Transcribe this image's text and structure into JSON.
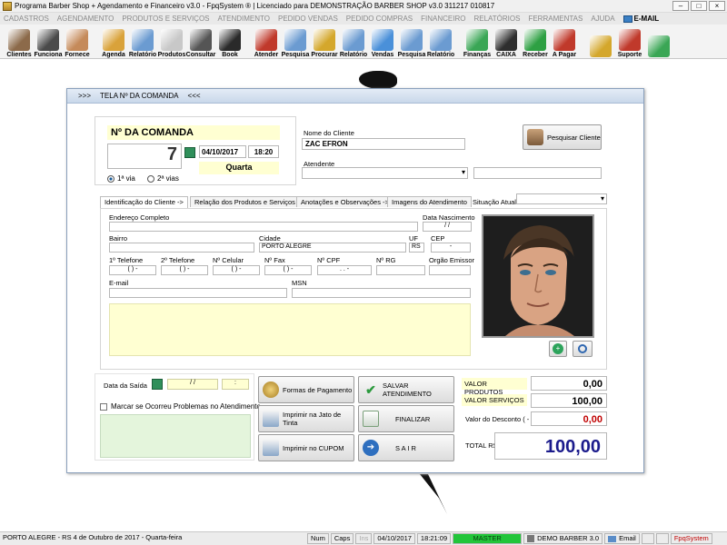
{
  "window": {
    "title": "Programa Barber Shop + Agendamento e Financeiro v3.0 - FpqSystem ® | Licenciado para  DEMONSTRAÇÃO BARBER SHOP v3.0 311217 010817"
  },
  "menu": [
    "CADASTROS",
    "AGENDAMENTO",
    "PRODUTOS E SERVIÇOS",
    "ATENDIMENTO",
    "PEDIDO VENDAS",
    "PEDIDO COMPRAS",
    "FINANCEIRO",
    "RELATÓRIOS",
    "FERRAMENTAS",
    "AJUDA"
  ],
  "menu_email": "E-MAIL",
  "toolbar": [
    {
      "label": "Clientes",
      "color": "#8c6a4a"
    },
    {
      "label": "Funciona",
      "color": "#4a4a4a"
    },
    {
      "label": "Fornece",
      "color": "#c58a5a"
    },
    {
      "label": "Agenda",
      "color": "#d9a23a"
    },
    {
      "label": "Relatório",
      "color": "#6b9bd1"
    },
    {
      "label": "Produtos",
      "color": "#c8c8c8"
    },
    {
      "label": "Consultar",
      "color": "#555555"
    },
    {
      "label": "Book",
      "color": "#2a2a2a"
    },
    {
      "label": "Atender",
      "color": "#c0392b"
    },
    {
      "label": "Pesquisa",
      "color": "#6b9bd1"
    },
    {
      "label": "Procurar",
      "color": "#d4a72c"
    },
    {
      "label": "Relatório",
      "color": "#6b9bd1"
    },
    {
      "label": "Vendas",
      "color": "#4a90d9"
    },
    {
      "label": "Pesquisa",
      "color": "#6b9bd1"
    },
    {
      "label": "Relatório",
      "color": "#6b9bd1"
    },
    {
      "label": "Finanças",
      "color": "#3aa655"
    },
    {
      "label": "CAIXA",
      "color": "#2e2e2e"
    },
    {
      "label": "Receber",
      "color": "#2ea043"
    },
    {
      "label": "A Pagar",
      "color": "#c0392b"
    },
    {
      "label": "",
      "color": "#d4a72c"
    },
    {
      "label": "Suporte",
      "color": "#c0392b"
    },
    {
      "label": "",
      "color": "#3aa655"
    }
  ],
  "dialog": {
    "caption_left": ">>>",
    "caption": "TELA Nº DA COMANDA",
    "caption_right": "<<<",
    "comanda_label": "Nº DA COMANDA",
    "comanda_number": "7",
    "date": "04/10/2017",
    "time": "18:20",
    "weekday": "Quarta",
    "via1": "1ª via",
    "via2": "2ª vias",
    "cliente_label": "Nome do Cliente",
    "cliente_value": "ZAC EFRON",
    "pesquisar_button": "Pesquisar Cliente",
    "atendente_label": "Atendente",
    "tabs": [
      "Identificação do Cliente ->",
      "Relação dos Produtos e Serviços ->",
      "Anotações e Observações ->",
      "Imagens do Atendimento"
    ],
    "situacao_label": "Situação Atual",
    "endereco_label": "Endereço Completo",
    "nascimento_label": "Data Nascimento",
    "nascimento_value": "/ /",
    "bairro_label": "Bairro",
    "cidade_label": "Cidade",
    "cidade_value": "PORTO ALEGRE",
    "uf_label": "UF",
    "uf_value": "RS",
    "cep_label": "CEP",
    "cep_value": "-",
    "tel1_label": "1º Telefone",
    "tel1_value": "( )   -",
    "tel2_label": "2º Telefone",
    "tel2_value": "( )   -",
    "cel_label": "Nº Celular",
    "cel_value": "( )   -",
    "fax_label": "Nº Fax",
    "fax_value": "( )   -",
    "cpf_label": "Nº CPF",
    "cpf_value": ".   .   -",
    "rg_label": "Nº RG",
    "orgao_label": "Orgão Emissor",
    "email_label": "E-mail",
    "msn_label": "MSN",
    "data_saida_label": "Data da Saída",
    "data_saida_value": "/ /",
    "hora_saida_value": ":",
    "problemas_label": "Marcar se Ocorreu Problemas no Atendimento",
    "btn_formas": "Formas de Pagamento",
    "btn_imprimir_jato": "Imprimir na Jato de Tinta",
    "btn_imprimir_cupom": "Imprimir no CUPOM",
    "btn_salvar": "SALVAR  ATENDIMENTO",
    "btn_finalizar": "FINALIZAR",
    "btn_sair": "S A I R",
    "valor_produtos_label": "VALOR PRODUTOS",
    "valor_produtos": "0,00",
    "valor_servicos_label": "VALOR SERVIÇOS",
    "valor_servicos": "100,00",
    "desconto_label": "Valor do Desconto ( - )",
    "desconto": "0,00",
    "total_label": "TOTAL R$",
    "total": "100,00"
  },
  "statusbar": {
    "location": "PORTO ALEGRE - RS   4 de Outubro de 2017 - Quarta-feira",
    "num": "Num",
    "caps": "Caps",
    "ins": "Ins",
    "date": "04/10/2017",
    "time": "18:21:09",
    "master": "MASTER",
    "company": "DEMO BARBER 3.0",
    "email": "Email",
    "brand": "FpqSystem"
  }
}
